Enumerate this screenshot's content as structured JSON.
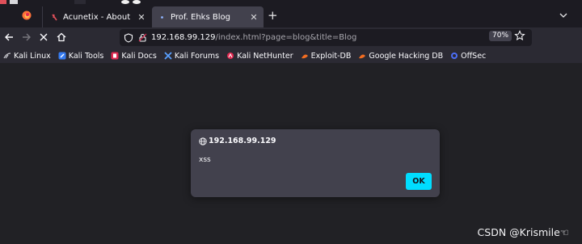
{
  "tabs": [
    {
      "title": "Acunetix - About",
      "close_glyph": "✕",
      "favicon": "kali-icon",
      "active": false
    },
    {
      "title": "Prof. Ehks Blog",
      "close_glyph": "✕",
      "favicon": "dot-icon",
      "active": true
    }
  ],
  "tabstrip": {
    "new_tab_glyph": "+"
  },
  "navbar": {
    "url_host": "192.168.99.129",
    "url_path": "/index.html?page=blog&title=Blog",
    "zoom": "70%"
  },
  "bookmarks": [
    {
      "label": "Kali Linux",
      "icon": "kali-dragon-icon"
    },
    {
      "label": "Kali Tools",
      "icon": "kali-tools-icon"
    },
    {
      "label": "Kali Docs",
      "icon": "kali-docs-icon"
    },
    {
      "label": "Kali Forums",
      "icon": "kali-forums-icon"
    },
    {
      "label": "Kali NetHunter",
      "icon": "nethunter-icon"
    },
    {
      "label": "Exploit-DB",
      "icon": "exploit-db-icon"
    },
    {
      "label": "Google Hacking DB",
      "icon": "ghdb-icon"
    },
    {
      "label": "OffSec",
      "icon": "offsec-icon"
    }
  ],
  "dialog": {
    "origin": "192.168.99.129",
    "message": "xss",
    "ok_label": "OK"
  },
  "watermark": "CSDN @Krismile☜",
  "colors": {
    "tabstrip_bg": "#1c1b22",
    "toolbar_bg": "#2b2a33",
    "content_bg": "#232327",
    "dialog_bg": "#42414d",
    "ok_button": "#00ddff"
  }
}
